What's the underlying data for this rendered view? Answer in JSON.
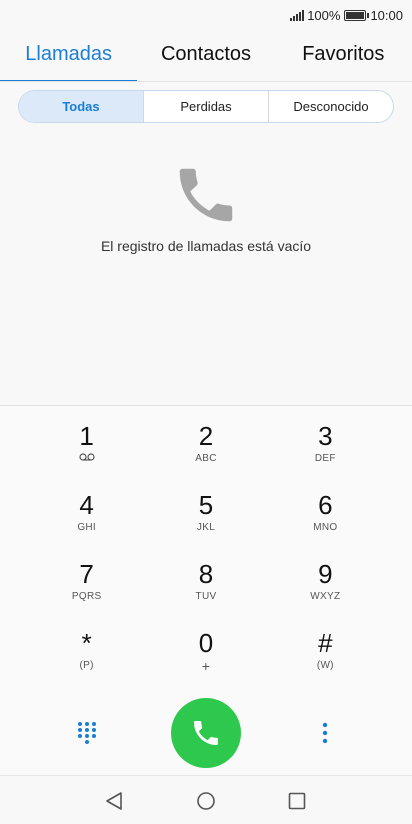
{
  "status_bar": {
    "battery_percent": "100%",
    "time": "10:00",
    "icons": [
      "signal-icon",
      "battery-icon"
    ]
  },
  "tabs": [
    {
      "label": "Llamadas",
      "active": true
    },
    {
      "label": "Contactos",
      "active": false
    },
    {
      "label": "Favoritos",
      "active": false
    }
  ],
  "filter": {
    "options": [
      {
        "label": "Todas",
        "active": true
      },
      {
        "label": "Perdidas",
        "active": false
      },
      {
        "label": "Desconocido",
        "active": false
      }
    ]
  },
  "empty_state": {
    "icon": "phone-icon",
    "message": "El registro de llamadas está vacío"
  },
  "dialpad": {
    "keys": [
      {
        "num": "1",
        "sub": ""
      },
      {
        "num": "2",
        "sub": "ABC"
      },
      {
        "num": "3",
        "sub": "DEF"
      },
      {
        "num": "4",
        "sub": "GHI"
      },
      {
        "num": "5",
        "sub": "JKL"
      },
      {
        "num": "6",
        "sub": "MNO"
      },
      {
        "num": "7",
        "sub": "PQRS"
      },
      {
        "num": "8",
        "sub": "TUV"
      },
      {
        "num": "9",
        "sub": "WXYZ"
      },
      {
        "num": "*",
        "sub": "(P)"
      },
      {
        "num": "0",
        "sub": "+"
      },
      {
        "num": "#",
        "sub": "(W)"
      }
    ],
    "voicemail_icon": "voicemail-icon",
    "actions": {
      "grid_icon": "dialpad-grid-icon",
      "call_icon": "call-icon",
      "more_icon": "more-vertical-icon"
    }
  },
  "navbar": {
    "icons": [
      "back-icon",
      "home-icon",
      "recents-icon"
    ]
  },
  "colors": {
    "accent": "#1a7ed6",
    "call_green": "#2dc84d",
    "empty_icon": "#a6a6a6"
  }
}
